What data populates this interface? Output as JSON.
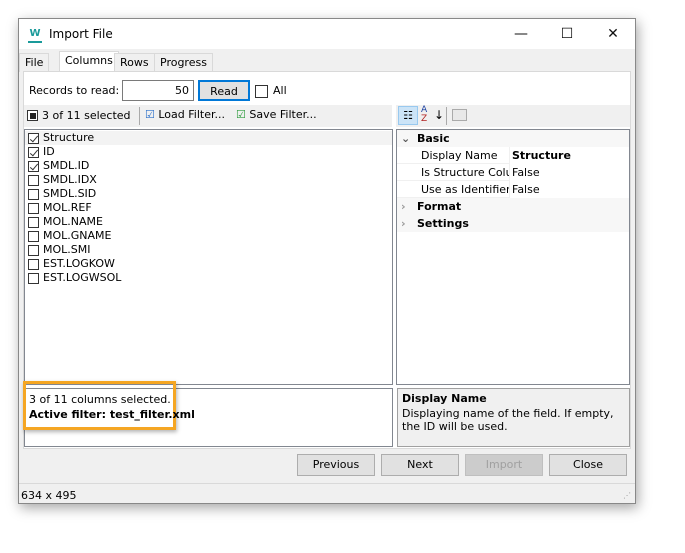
{
  "window": {
    "title": "Import File",
    "minimize": "—",
    "maximize": "☐",
    "close": "✕"
  },
  "tabs": [
    {
      "label": "File"
    },
    {
      "label": "Columns",
      "active": true
    },
    {
      "label": "Rows"
    },
    {
      "label": "Progress"
    }
  ],
  "records": {
    "label": "Records to read:",
    "value": "50",
    "read_label": "Read",
    "all_label": "All"
  },
  "toolbar": {
    "selected_label": "3 of 11 selected",
    "load_filter": "Load Filter...",
    "save_filter": "Save Filter..."
  },
  "columns": [
    {
      "name": "Structure",
      "checked": true
    },
    {
      "name": "ID",
      "checked": true
    },
    {
      "name": "SMDL.ID",
      "checked": true
    },
    {
      "name": "SMDL.IDX",
      "checked": false
    },
    {
      "name": "SMDL.SID",
      "checked": false
    },
    {
      "name": "MOL.REF",
      "checked": false
    },
    {
      "name": "MOL.NAME",
      "checked": false
    },
    {
      "name": "MOL.GNAME",
      "checked": false
    },
    {
      "name": "MOL.SMI",
      "checked": false
    },
    {
      "name": "EST.LOGKOW",
      "checked": false
    },
    {
      "name": "EST.LOGWSOL",
      "checked": false
    }
  ],
  "properties": {
    "basic": "Basic",
    "rows": [
      {
        "name": "Display Name",
        "value": "Structure"
      },
      {
        "name": "Is Structure Column",
        "value": "False"
      },
      {
        "name": "Use as Identifier",
        "value": "False"
      }
    ],
    "format": "Format",
    "settings": "Settings"
  },
  "summary": {
    "line1": "3 of 11 columns selected.",
    "line2": "Active filter: test_filter.xml",
    "highlight_color": "#f5a623"
  },
  "help": {
    "title": "Display Name",
    "text": "Displaying name of the field. If empty, the ID will be used."
  },
  "buttons": {
    "previous": "Previous",
    "next": "Next",
    "import": "Import",
    "close": "Close"
  },
  "status": {
    "size": "634 x 495"
  }
}
